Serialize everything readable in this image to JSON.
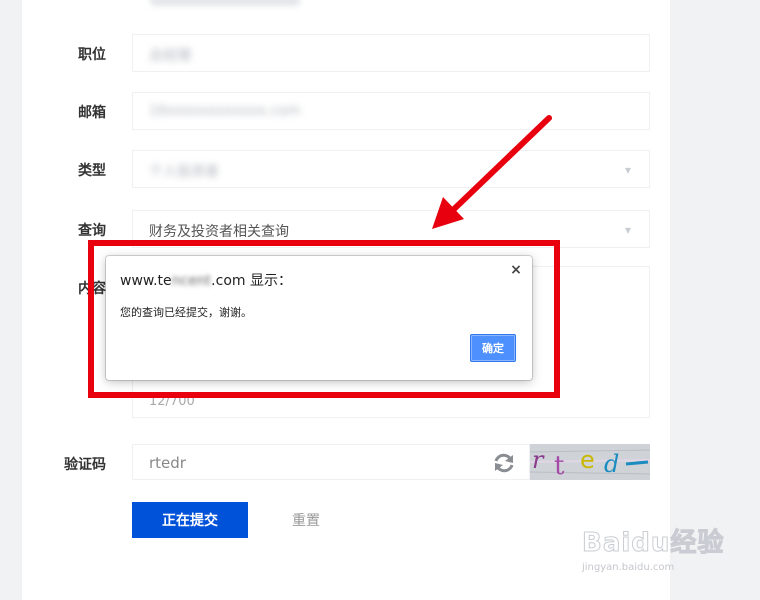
{
  "form": {
    "fields": [
      {
        "label": "职位",
        "value": "总经理",
        "blurred": true
      },
      {
        "label": "邮箱",
        "value": "16xxxxxxxxxxxx.com",
        "blurred": true
      },
      {
        "label": "类型",
        "value": "个人投资者",
        "blurred": true
      },
      {
        "label": "查询",
        "value": "财务及投资者相关查询",
        "blurred": false
      }
    ],
    "content": {
      "label": "内容",
      "counter": "12/700"
    },
    "captcha": {
      "label": "验证码",
      "value": "rtedr",
      "image_text": "rted"
    },
    "submit_label": "正在提交",
    "reset_label": "重置"
  },
  "dialog": {
    "host_prefix": "www.te",
    "host_blur": "ncent",
    "host_suffix": ".com 显示：",
    "message": "您的查询已经提交，谢谢。",
    "ok_label": "确定",
    "close_glyph": "×"
  },
  "watermark": {
    "brand": "Baidu经验",
    "url": "jingyan.baidu.com"
  },
  "colors": {
    "primary": "#0052d9",
    "highlight_red": "#e8000e",
    "dialog_button": "#4d90fe"
  }
}
